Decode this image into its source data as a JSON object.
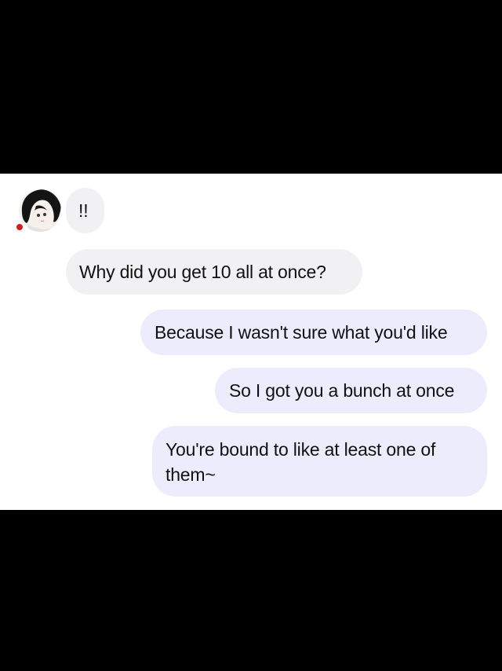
{
  "chat": {
    "contact": {
      "avatar_icon": "anime-girl-avatar-icon",
      "status_color": "#d91a1a"
    },
    "messages": [
      {
        "side": "incoming",
        "text": "!!"
      },
      {
        "side": "incoming",
        "text": "Why did you get 10 all at once?"
      },
      {
        "side": "outgoing",
        "text": "Because I wasn't sure what you'd like"
      },
      {
        "side": "outgoing",
        "text": "So I got you a bunch at once"
      },
      {
        "side": "outgoing",
        "lines": [
          "You're bound to like at least one of",
          "them~"
        ]
      }
    ]
  },
  "colors": {
    "letterbox": "#000000",
    "panel": "#ffffff",
    "incoming_bubble": "#f1f1f3",
    "outgoing_bubble": "#ececfd",
    "text": "#111111"
  }
}
